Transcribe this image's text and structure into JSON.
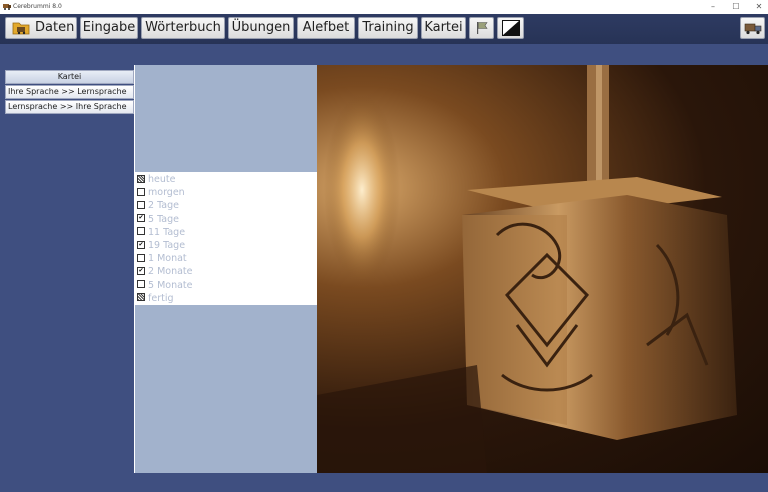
{
  "window": {
    "title": "Cerebrummi 8.0",
    "controls": {
      "minimize": "–",
      "maximize": "☐",
      "close": "✕"
    }
  },
  "toolbar": {
    "buttons": [
      {
        "label": "Daten",
        "icon": "folder-icon"
      },
      {
        "label": "Eingabe"
      },
      {
        "label": "Wörterbuch"
      },
      {
        "label": "Übungen"
      },
      {
        "label": "Alefbet"
      },
      {
        "label": "Training"
      },
      {
        "label": "Kartei"
      },
      {
        "icon": "flag-icon"
      },
      {
        "icon": "contrast-icon"
      }
    ],
    "right_icon": "truck-icon"
  },
  "left_panel": {
    "header": "Kartei",
    "options": [
      "Ihre Sprache >> Lernsprache",
      "Lernsprache >> Ihre Sprache"
    ]
  },
  "states": [
    {
      "label": "heute",
      "mark": "partial"
    },
    {
      "label": "morgen",
      "mark": "empty"
    },
    {
      "label": "2 Tage",
      "mark": "empty"
    },
    {
      "label": "5 Tage",
      "mark": "checked"
    },
    {
      "label": "11 Tage",
      "mark": "empty"
    },
    {
      "label": "19 Tage",
      "mark": "checked"
    },
    {
      "label": "1 Monat",
      "mark": "empty"
    },
    {
      "label": "2 Monate",
      "mark": "checked"
    },
    {
      "label": "5 Monate",
      "mark": "empty"
    },
    {
      "label": "fertig",
      "mark": "partial"
    }
  ],
  "image": {
    "subject": "dreidel",
    "tone_dark": "#1a0d05",
    "tone_light": "#d9a86a"
  },
  "colors": {
    "background": "#3f4f80",
    "toolbar": "#2a3659",
    "panel": "#a2b2cc",
    "text_muted": "#b3bdd1"
  }
}
